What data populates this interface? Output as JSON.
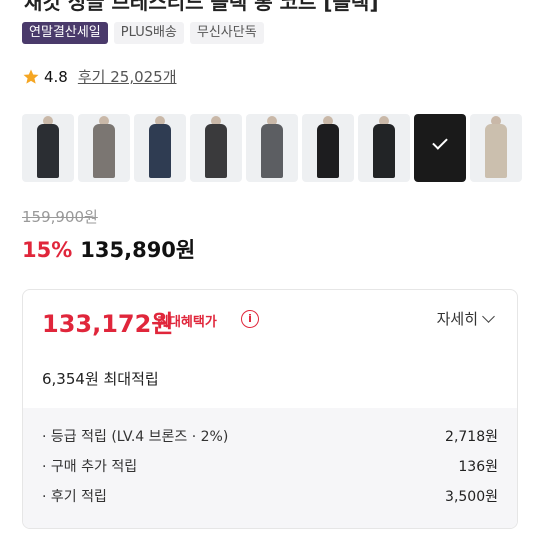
{
  "product": {
    "title_partial": "재킷 싱글 브레스티드 블랙 롱 코트 [블랙]"
  },
  "badges": [
    "연말결산세일",
    "PLUS배송",
    "무신사단독"
  ],
  "rating": {
    "score": "4.8",
    "reviews": "후기 25,025개",
    "icon": "star-icon",
    "star_color": "#f5a623"
  },
  "thumbnails": [
    {
      "color": "#2b2e33"
    },
    {
      "color": "#7b7672"
    },
    {
      "color": "#2f3c52"
    },
    {
      "color": "#3a3a3c"
    },
    {
      "color": "#5c5e62"
    },
    {
      "color": "#1d1d1f"
    },
    {
      "color": "#222426"
    },
    {
      "color": "#111111",
      "selected": true
    },
    {
      "color": "#cbbfae"
    }
  ],
  "pricing": {
    "original": "159,900원",
    "discount": "15%",
    "final": "135,890원"
  },
  "benefit": {
    "max_price": "133,172원",
    "max_label": "최대혜택가",
    "info_icon": "i",
    "detail_label": "자세히",
    "max_points": "6,354원 최대적립",
    "items": [
      {
        "label": "· 등급 적립 (LV.4 브론즈 · 2%)",
        "value": "2,718원"
      },
      {
        "label": "· 구매 추가 적립",
        "value": "136원"
      },
      {
        "label": "· 후기 적립",
        "value": "3,500원"
      }
    ]
  },
  "colors": {
    "accent_red": "#e0263b",
    "badge_purple": "#4a3a6b"
  }
}
